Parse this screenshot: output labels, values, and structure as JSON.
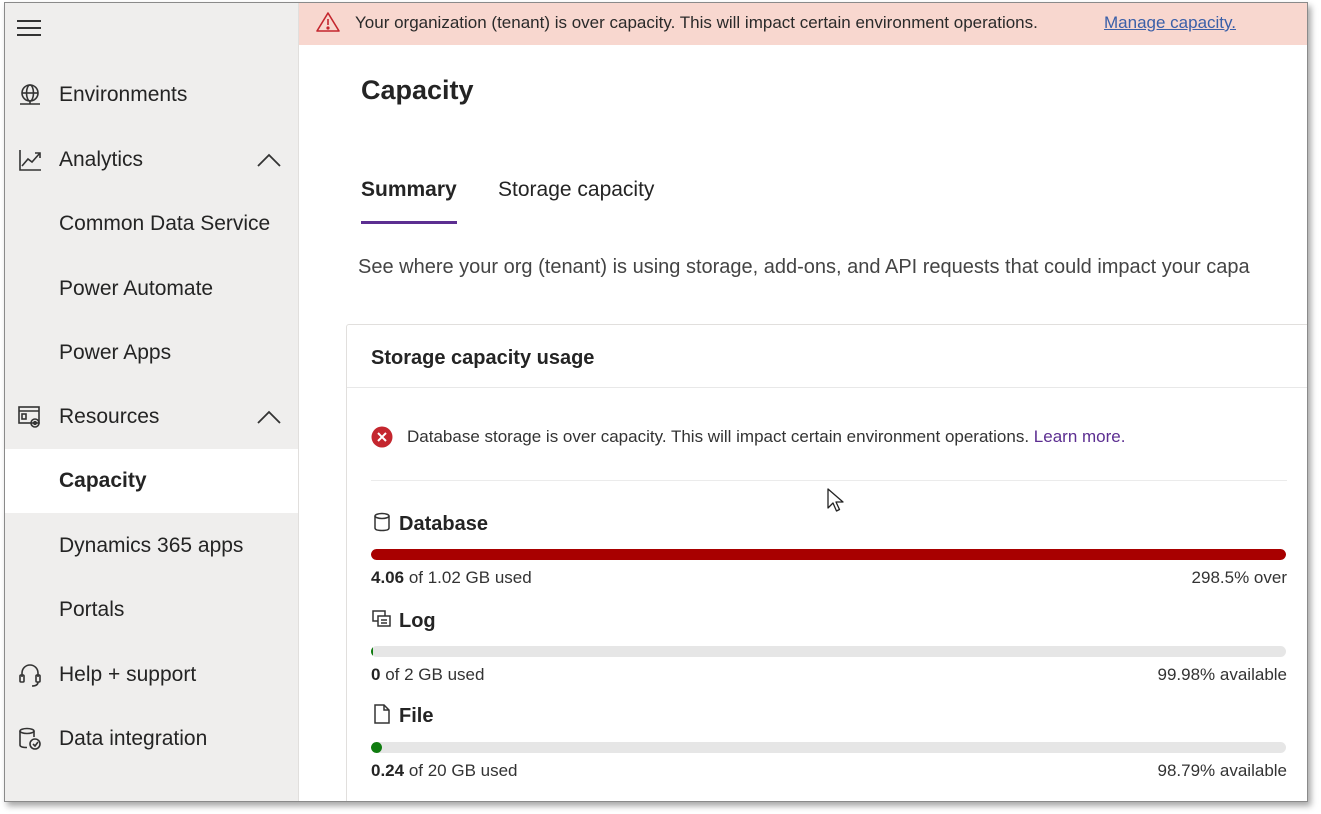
{
  "colors": {
    "banner_bg": "#f8d7cf",
    "accent_purple": "#5c2e91",
    "error_red": "#c4262e",
    "database_bar": "#a80000",
    "log_bar": "#107c10",
    "file_bar": "#107c10",
    "sidebar_bg": "#efeeed"
  },
  "sidebar": {
    "menu_icon": "hamburger-icon",
    "items": [
      {
        "label": "Environments",
        "icon": "globe-icon"
      },
      {
        "label": "Analytics",
        "icon": "chart-icon",
        "expanded": true
      },
      {
        "label": "Common Data Service"
      },
      {
        "label": "Power Automate"
      },
      {
        "label": "Power Apps"
      },
      {
        "label": "Resources",
        "icon": "resources-icon",
        "expanded": true
      },
      {
        "label": "Capacity",
        "selected": true
      },
      {
        "label": "Dynamics 365 apps"
      },
      {
        "label": "Portals"
      },
      {
        "label": "Help + support",
        "icon": "headset-icon"
      },
      {
        "label": "Data integration",
        "icon": "data-integration-icon"
      }
    ]
  },
  "banner": {
    "icon": "warning-icon",
    "text": "Your organization (tenant) is over capacity. This will impact certain environment operations.",
    "link": "Manage capacity."
  },
  "page": {
    "title": "Capacity",
    "tabs": [
      {
        "label": "Summary",
        "active": true
      },
      {
        "label": "Storage capacity",
        "active": false
      }
    ],
    "description": "See where your org (tenant) is using storage, add-ons, and API requests that could impact your capa"
  },
  "storage_card": {
    "title": "Storage capacity usage",
    "error_icon": "error-circle-icon",
    "error_text": "Database storage is over capacity. This will impact certain environment operations.",
    "error_link": "Learn more.",
    "metrics": [
      {
        "name": "Database",
        "icon": "database-icon",
        "used": "4.06",
        "used_suffix": "of 1.02 GB used",
        "status": "298.5% over",
        "fill_fraction": 1.0
      },
      {
        "name": "Log",
        "icon": "log-icon",
        "used": "0",
        "used_suffix": "of 2 GB used",
        "status": "99.98% available",
        "fill_fraction": 0.0002
      },
      {
        "name": "File",
        "icon": "file-icon",
        "used": "0.24",
        "used_suffix": "of 20 GB used",
        "status": "98.79% available",
        "fill_fraction": 0.012
      }
    ]
  }
}
